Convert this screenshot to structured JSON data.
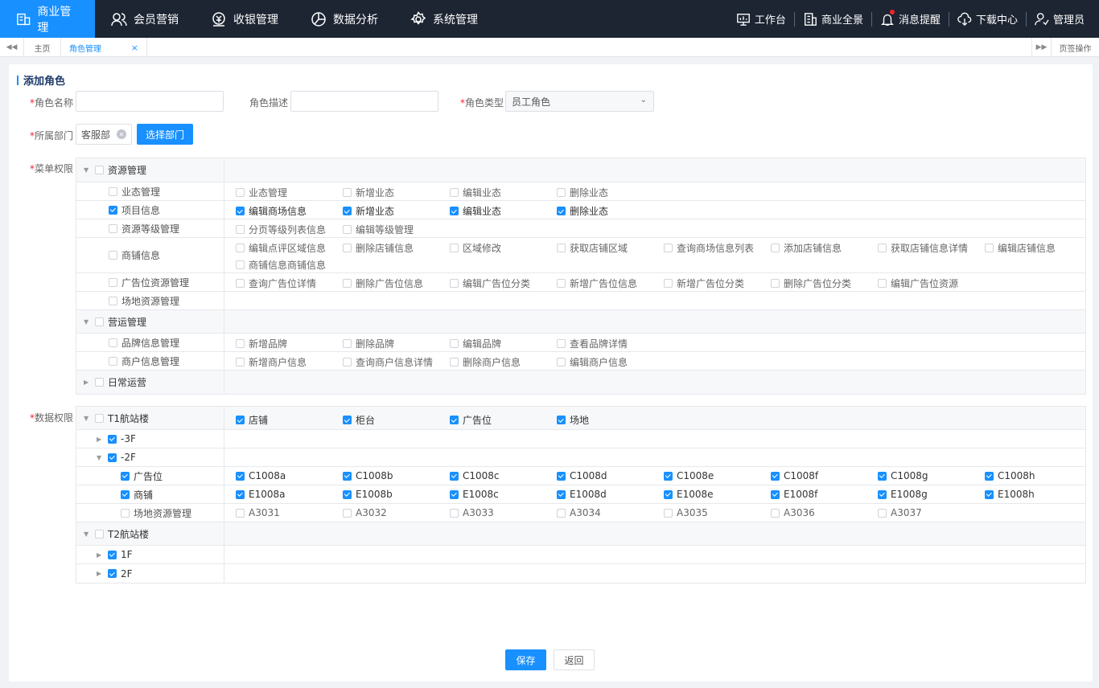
{
  "nav": {
    "items": [
      {
        "label": "商业管理",
        "icon": "building-icon",
        "active": true
      },
      {
        "label": "会员营销",
        "icon": "users-icon",
        "active": false
      },
      {
        "label": "收银管理",
        "icon": "cashier-icon",
        "active": false
      },
      {
        "label": "数据分析",
        "icon": "pie-chart-icon",
        "active": false
      },
      {
        "label": "系统管理",
        "icon": "gear-icon",
        "active": false
      }
    ],
    "right": [
      {
        "label": "工作台",
        "icon": "monitor-icon"
      },
      {
        "label": "商业全景",
        "icon": "building-icon"
      },
      {
        "label": "消息提醒",
        "icon": "bell-icon"
      },
      {
        "label": "下载中心",
        "icon": "cloud-download-icon"
      },
      {
        "label": "管理员",
        "icon": "user-icon"
      }
    ]
  },
  "tabs": {
    "home": "主页",
    "current": "角色管理",
    "close": "×",
    "ops": "页签操作"
  },
  "form": {
    "title": "添加角色",
    "role_name_label": "角色名称",
    "role_desc_label": "角色描述",
    "role_type_label": "角色类型",
    "role_type_value": "员工角色",
    "dept_label": "所属部门",
    "dept_value": "客服部",
    "choose_dept": "选择部门",
    "menu_perm_label": "菜单权限",
    "data_perm_label": "数据权限",
    "required_mark": "*",
    "save": "保存",
    "back": "返回"
  },
  "menu_perms": {
    "group1": "资源管理",
    "r1": {
      "name": "业态管理",
      "perms": [
        "业态管理",
        "新增业态",
        "编辑业态",
        "删除业态"
      ]
    },
    "r2": {
      "name": "项目信息",
      "perms": [
        "编辑商场信息",
        "新增业态",
        "编辑业态",
        "删除业态"
      ]
    },
    "r3": {
      "name": "资源等级管理",
      "perms": [
        "分页等级列表信息",
        "编辑等级管理"
      ]
    },
    "r4": {
      "name": "商铺信息",
      "perms": [
        "编辑点评区域信息",
        "删除店铺信息",
        "区域修改",
        "获取店铺区域",
        "查询商场信息列表",
        "添加店铺信息",
        "获取店铺信息详情",
        "编辑店铺信息",
        "商铺信息商铺信息"
      ]
    },
    "r5": {
      "name": "广告位资源管理",
      "perms": [
        "查询广告位详情",
        "删除广告位信息",
        "编辑广告位分类",
        "新增广告位信息",
        "新增广告位分类",
        "删除广告位分类",
        "编辑广告位资源"
      ]
    },
    "r6": {
      "name": "场地资源管理"
    },
    "group2": "营运管理",
    "r7": {
      "name": "品牌信息管理",
      "perms": [
        "新增品牌",
        "删除品牌",
        "编辑品牌",
        "查看品牌详情"
      ]
    },
    "r8": {
      "name": "商户信息管理",
      "perms": [
        "新增商户信息",
        "查询商户信息详情",
        "删除商户信息",
        "编辑商户信息"
      ]
    },
    "group3": "日常运营"
  },
  "data_perms": {
    "t1": "T1航站楼",
    "t1_types": [
      "店铺",
      "柜台",
      "广告位",
      "场地"
    ],
    "f1": "-3F",
    "f2": "-2F",
    "ad": {
      "name": "广告位",
      "items": [
        "C1008a",
        "C1008b",
        "C1008c",
        "C1008d",
        "C1008e",
        "C1008f",
        "C1008g",
        "C1008h"
      ]
    },
    "shop": {
      "name": "商铺",
      "items": [
        "E1008a",
        "E1008b",
        "E1008c",
        "E1008d",
        "E1008e",
        "E1008f",
        "E1008g",
        "E1008h"
      ]
    },
    "venue": {
      "name": "场地资源管理",
      "items": [
        "A3031",
        "A3032",
        "A3033",
        "A3034",
        "A3035",
        "A3036",
        "A3037"
      ]
    },
    "t2": "T2航站楼",
    "f3": "1F",
    "f4": "2F"
  }
}
